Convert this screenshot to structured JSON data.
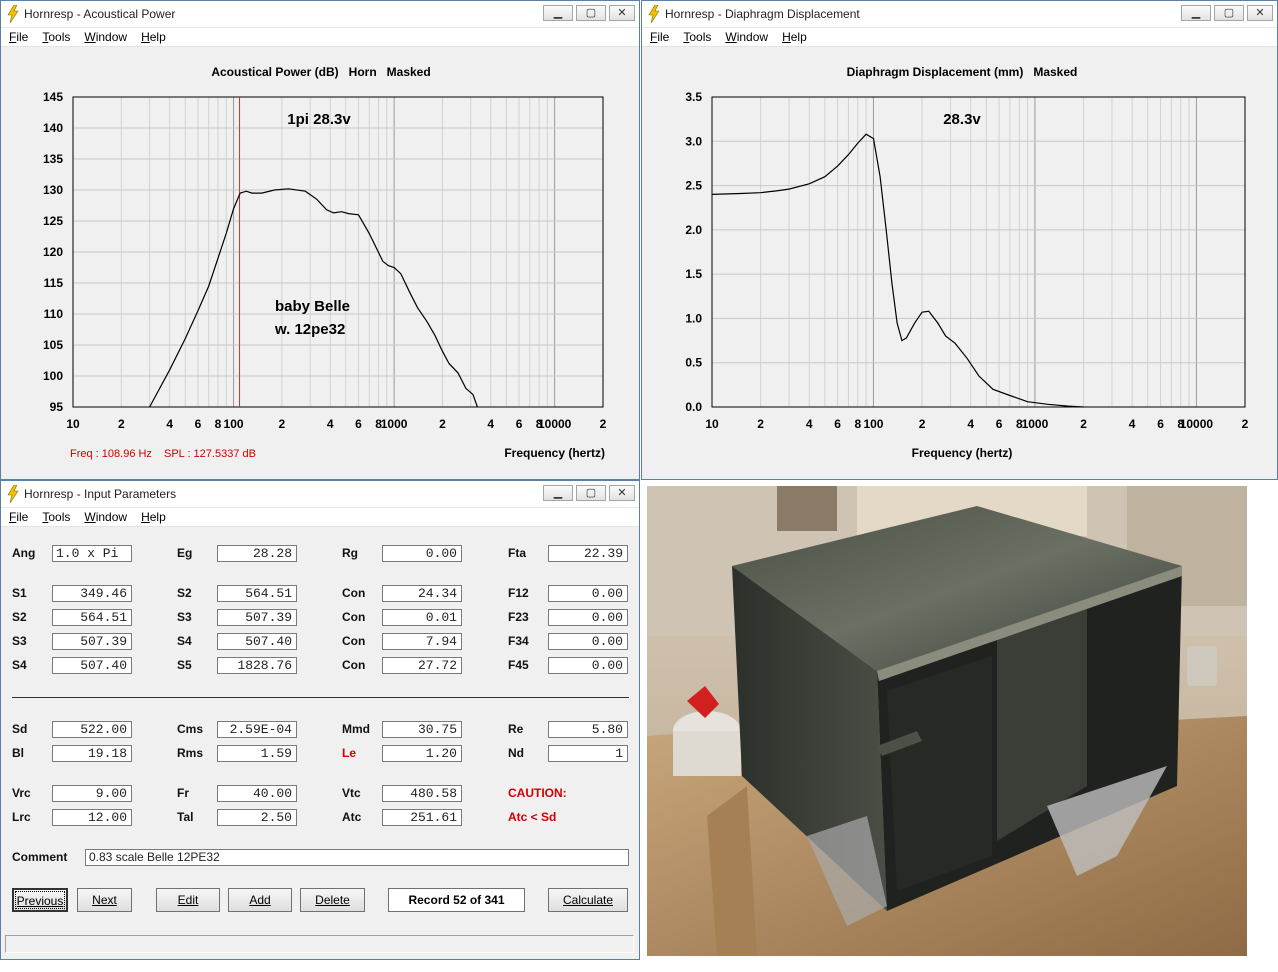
{
  "colors": {
    "window_border": "#5a7fa8",
    "red_text": "#d00000",
    "curve": "#000000",
    "grid": "#c8c8c8",
    "cursor_line": "#c0392b"
  },
  "window_power": {
    "title": "Hornresp - Acoustical Power",
    "menu": [
      "File",
      "Tools",
      "Window",
      "Help"
    ],
    "graph_title": "Acoustical Power (dB)   Horn   Masked",
    "annotation1": "1pi 28.3v",
    "annotation2": "baby Belle",
    "annotation3": "w. 12pe32",
    "xlabel": "Frequency (hertz)",
    "freq_readout": "Freq : 108.96 Hz",
    "spl_readout": "SPL : 127.5337 dB"
  },
  "window_disp": {
    "title": "Hornresp - Diaphragm Displacement",
    "menu": [
      "File",
      "Tools",
      "Window",
      "Help"
    ],
    "graph_title": "Diaphragm Displacement (mm)   Masked",
    "annotation1": "28.3v",
    "xlabel": "Frequency (hertz)"
  },
  "window_input": {
    "title": "Hornresp - Input Parameters",
    "menu": [
      "File",
      "Tools",
      "Window",
      "Help"
    ],
    "col1": [
      {
        "label": "Ang",
        "value": "1.0 x Pi"
      },
      {
        "label": "S1",
        "value": "349.46"
      },
      {
        "label": "S2",
        "value": "564.51"
      },
      {
        "label": "S3",
        "value": "507.39"
      },
      {
        "label": "S4",
        "value": "507.40"
      },
      {
        "label": "Sd",
        "value": "522.00"
      },
      {
        "label": "Bl",
        "value": "19.18"
      },
      {
        "label": "Vrc",
        "value": "9.00"
      },
      {
        "label": "Lrc",
        "value": "12.00"
      }
    ],
    "col2": [
      {
        "label": "Eg",
        "value": "28.28"
      },
      {
        "label": "S2",
        "value": "564.51"
      },
      {
        "label": "S3",
        "value": "507.39"
      },
      {
        "label": "S4",
        "value": "507.40"
      },
      {
        "label": "S5",
        "value": "1828.76"
      },
      {
        "label": "Cms",
        "value": "2.59E-04"
      },
      {
        "label": "Rms",
        "value": "1.59"
      },
      {
        "label": "Fr",
        "value": "40.00"
      },
      {
        "label": "Tal",
        "value": "2.50"
      }
    ],
    "col3": [
      {
        "label": "Rg",
        "value": "0.00"
      },
      {
        "label": "Con",
        "value": "24.34"
      },
      {
        "label": "Con",
        "value": "0.01"
      },
      {
        "label": "Con",
        "value": "7.94"
      },
      {
        "label": "Con",
        "value": "27.72"
      },
      {
        "label": "Mmd",
        "value": "30.75"
      },
      {
        "label": "Le",
        "value": "1.20"
      },
      {
        "label": "Vtc",
        "value": "480.58"
      },
      {
        "label": "Atc",
        "value": "251.61"
      }
    ],
    "col4": [
      {
        "label": "Fta",
        "value": "22.39"
      },
      {
        "label": "F12",
        "value": "0.00"
      },
      {
        "label": "F23",
        "value": "0.00"
      },
      {
        "label": "F34",
        "value": "0.00"
      },
      {
        "label": "F45",
        "value": "0.00"
      },
      {
        "label": "Re",
        "value": "5.80"
      },
      {
        "label": "Nd",
        "value": "1"
      }
    ],
    "caution1": "CAUTION:",
    "caution2": "Atc < Sd",
    "comment_label": "Comment",
    "comment_value": "0.83 scale Belle  12PE32",
    "buttons": {
      "previous": "Previous",
      "next": "Next",
      "edit": "Edit",
      "add": "Add",
      "delete": "Delete",
      "record": "Record 52 of 341",
      "calculate": "Calculate"
    }
  },
  "chart_data": [
    {
      "type": "line",
      "title": "Acoustical Power (dB)   Horn   Masked",
      "xlabel": "Frequency (hertz)",
      "ylabel": "",
      "xscale": "log",
      "xlim": [
        10,
        20000
      ],
      "ylim": [
        95,
        145
      ],
      "yticks": [
        95,
        100,
        105,
        110,
        115,
        120,
        125,
        130,
        135,
        140,
        145
      ],
      "xtick_labels": [
        "10",
        "2",
        "4",
        "6",
        "8",
        "100",
        "2",
        "4",
        "6",
        "8",
        "1000",
        "2",
        "4",
        "6",
        "8",
        "10000",
        "2"
      ],
      "grid": true,
      "cursor_x": 108.96,
      "series": [
        {
          "x": [
            30,
            40,
            50,
            60,
            70,
            80,
            90,
            100,
            110,
            120,
            130,
            150,
            180,
            220,
            280,
            330,
            380,
            420,
            470,
            520,
            600,
            700,
            780,
            850,
            920,
            1000,
            1100,
            1250,
            1400,
            1600,
            1800,
            2000,
            2200,
            2500,
            2800,
            3100,
            3300
          ],
          "y": [
            95,
            101,
            106,
            110.5,
            114.5,
            119,
            123,
            127,
            129.5,
            129.8,
            129.5,
            129.5,
            130,
            130.2,
            129.8,
            128.5,
            126.8,
            126.3,
            126.5,
            126.2,
            126,
            123,
            120.5,
            118.5,
            117.8,
            117.5,
            116.5,
            113.5,
            111,
            108.8,
            106.5,
            104,
            102,
            100.5,
            98,
            97,
            95
          ]
        }
      ]
    },
    {
      "type": "line",
      "title": "Diaphragm Displacement (mm)   Masked",
      "xlabel": "Frequency (hertz)",
      "ylabel": "",
      "xscale": "log",
      "xlim": [
        10,
        20000
      ],
      "ylim": [
        0,
        3.5
      ],
      "yticks": [
        0.0,
        0.5,
        1.0,
        1.5,
        2.0,
        2.5,
        3.0,
        3.5
      ],
      "xtick_labels": [
        "10",
        "2",
        "4",
        "6",
        "8",
        "100",
        "2",
        "4",
        "6",
        "8",
        "1000",
        "2",
        "4",
        "6",
        "8",
        "10000",
        "2"
      ],
      "grid": true,
      "series": [
        {
          "x": [
            10,
            15,
            20,
            25,
            30,
            40,
            50,
            60,
            70,
            80,
            90,
            100,
            110,
            120,
            130,
            140,
            150,
            160,
            180,
            200,
            220,
            250,
            280,
            320,
            380,
            450,
            550,
            700,
            900,
            1200,
            1600,
            2000
          ],
          "y": [
            2.4,
            2.41,
            2.42,
            2.44,
            2.46,
            2.52,
            2.6,
            2.72,
            2.85,
            2.98,
            3.08,
            3.03,
            2.6,
            2.0,
            1.4,
            0.95,
            0.75,
            0.78,
            0.95,
            1.07,
            1.08,
            0.95,
            0.8,
            0.72,
            0.55,
            0.35,
            0.2,
            0.13,
            0.06,
            0.03,
            0.01,
            0.0
          ]
        }
      ]
    }
  ]
}
